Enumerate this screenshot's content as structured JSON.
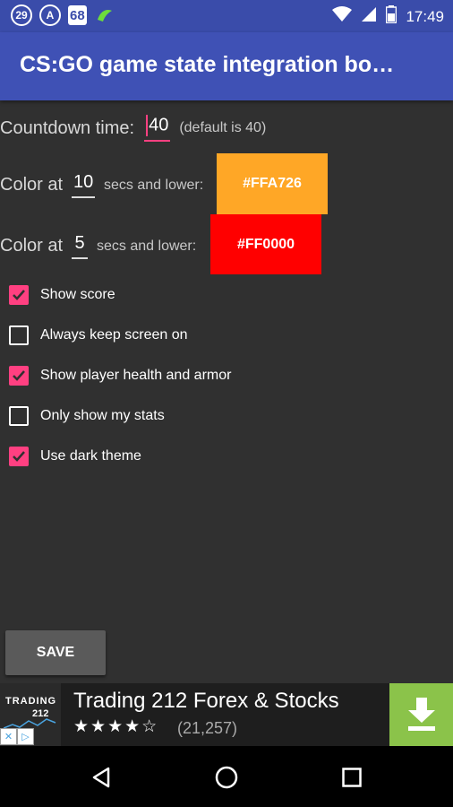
{
  "status_bar": {
    "notif_icons": [
      "29",
      "A",
      "68"
    ],
    "time": "17:49"
  },
  "app_bar": {
    "title": "CS:GO game state integration bo…"
  },
  "settings": {
    "countdown": {
      "label": "Countdown time:",
      "value": "40",
      "hint": "(default is 40)"
    },
    "color1": {
      "label": "Color at",
      "value": "10",
      "suffix": "secs and lower:",
      "color_label": "#FFA726",
      "color": "#FFA726"
    },
    "color2": {
      "label": "Color at",
      "value": "5",
      "suffix": "secs and lower:",
      "color_label": "#FF0000",
      "color": "#FF0000"
    }
  },
  "checkboxes": [
    {
      "label": "Show score",
      "checked": true
    },
    {
      "label": "Always keep screen on",
      "checked": false
    },
    {
      "label": "Show player health and armor",
      "checked": true
    },
    {
      "label": "Only show my stats",
      "checked": false
    },
    {
      "label": "Use dark theme",
      "checked": true
    }
  ],
  "save_label": "SAVE",
  "ad": {
    "logo_line1": "TRADING",
    "logo_line2": "212",
    "title": "Trading 212 Forex & Stocks",
    "stars": "★★★★☆",
    "rating_count": "(21,257)"
  },
  "colors": {
    "accent": "#FF4081",
    "appbar": "#3F51B5",
    "statusbar": "#3A4CAA",
    "background": "#303030",
    "download": "#8BC34A"
  }
}
